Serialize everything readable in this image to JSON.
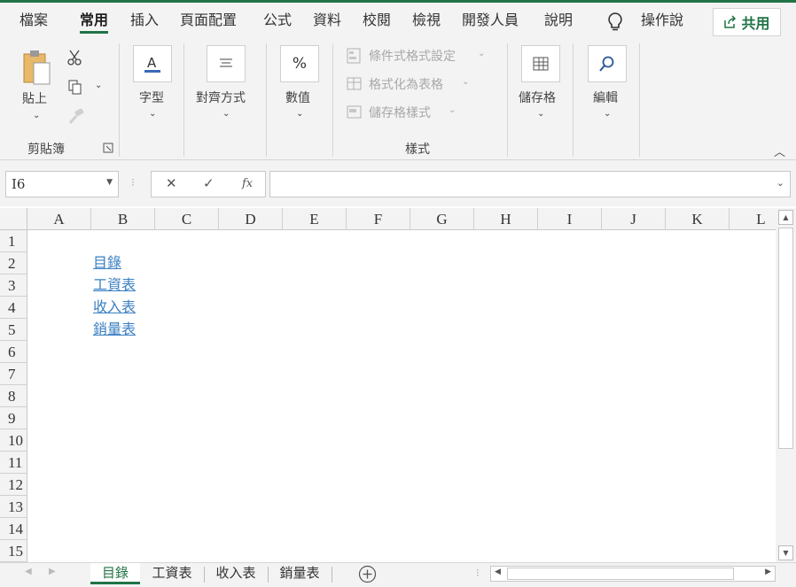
{
  "menu": {
    "tabs": [
      "檔案",
      "常用",
      "插入",
      "頁面配置",
      "公式",
      "資料",
      "校閱",
      "檢視",
      "開發人員",
      "說明"
    ],
    "active": "常用",
    "search_label": "操作說",
    "share_label": "共用"
  },
  "ribbon": {
    "clipboard": {
      "paste_label": "貼上",
      "group_label": "剪貼簿"
    },
    "font_label": "字型",
    "align_label": "對齊方式",
    "number_label": "數值",
    "styles": {
      "conditional": "條件式格式設定",
      "table": "格式化為表格",
      "cell_styles": "儲存格樣式",
      "group_label": "樣式"
    },
    "cells_label": "儲存格",
    "edit_label": "編輯"
  },
  "formula_bar": {
    "name_box": "I6",
    "cancel": "✕",
    "enter": "✓",
    "fx": "fx",
    "formula": ""
  },
  "grid": {
    "columns": [
      "A",
      "B",
      "C",
      "D",
      "E",
      "F",
      "G",
      "H",
      "I",
      "J",
      "K",
      "L"
    ],
    "rows": [
      "1",
      "2",
      "3",
      "4",
      "5",
      "6",
      "7",
      "8",
      "9",
      "10",
      "11",
      "12",
      "13",
      "14",
      "15"
    ],
    "links": [
      "目錄",
      "工資表",
      "收入表",
      "銷量表"
    ]
  },
  "sheets": {
    "tabs": [
      "目錄",
      "工資表",
      "收入表",
      "銷量表"
    ],
    "active": "目錄"
  }
}
